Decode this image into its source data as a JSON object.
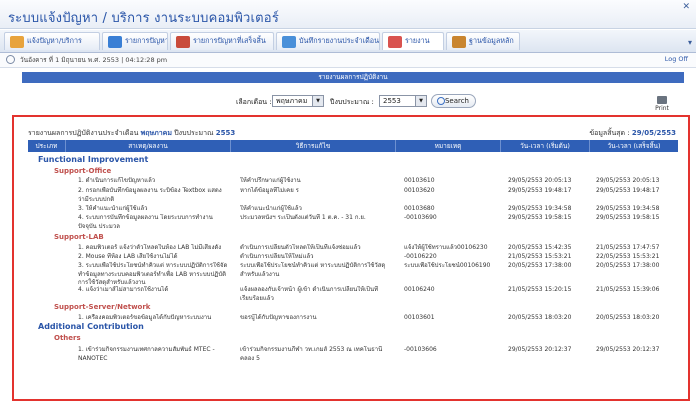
{
  "app": {
    "title": "ระบบแจ้งปัญหา / บริการ   งานระบบคอมพิวเตอร์"
  },
  "tabs": [
    {
      "label": "แจ้งปัญหา/บริการ",
      "color": "#e8a33c"
    },
    {
      "label": "รายการปัญหา",
      "color": "#3a7fd5"
    },
    {
      "label": "รายการปัญหาที่เสร็จสิ้น",
      "color": "#c94b3b"
    },
    {
      "label": "บันทึกรายงานประจำเดือน",
      "color": "#4a90d9"
    },
    {
      "label": "รายงาน",
      "color": "#d9534f"
    },
    {
      "label": "ฐานข้อมูลหลัก",
      "color": "#c9852f"
    }
  ],
  "status": {
    "date": "วันอังคาร ที่ 1 มิถุนายน พ.ศ. 2553  |  04:12:28 pm",
    "logoff": "Log Off"
  },
  "header_bar": "รายงานผลการปฏิบัติงาน",
  "filter": {
    "month_label": "เลือกเดือน :",
    "month_value": "พฤษภาคม",
    "year_label": "ปีงบประมาณ :",
    "year_value": "2553",
    "search_label": "Search",
    "print_label": "Print"
  },
  "report": {
    "title_prefix": "รายงานผลการปฏิบัติงานประจำเดือน",
    "month": "พฤษภาคม",
    "year_prefix": "ปีงบประมาณ",
    "year": "2553",
    "asof_label": "ข้อมูลสิ้นสุด :",
    "asof_date": "29/05/2553"
  },
  "columns": [
    "ประเภท",
    "สาเหตุ/ผลงาน",
    "วิธีการแก้ไข",
    "หมายเหตุ",
    "วัน-เวลา (เริ่มต้น)",
    "วัน-เวลา (เสร็จสิ้น)"
  ],
  "groups": [
    {
      "name": "Functional Improvement",
      "subs": [
        {
          "name": "Support-Office",
          "rows": [
            {
              "cause": "1. ดำเนินการแก้ไขปัญหาแล้ว",
              "fix": "ให้คำปรึกษาแก่ผู้ใช้งาน",
              "note": "00103610",
              "start": "29/05/2553  20:05:13",
              "end": "29/05/2553  20:05:13"
            },
            {
              "cause": "2. กรอกเพื่อบันทึกข้อมูลผลงาน ระบิข้อง Textbox แสดง ว่ามีระบบปกติ",
              "fix": "หากได้ข้อมูลที่ไม่เคย ร",
              "note": "00103620",
              "start": "29/05/2553  19:48:17",
              "end": "29/05/2553  19:48:17"
            },
            {
              "cause": "3. ให้คำแนะนำแก่ผู้ใช้แล้ว",
              "fix": "ให้คำแนะนำแก่ผู้ใช้แล้ว",
              "note": "00103680",
              "start": "29/05/2553  19:34:58",
              "end": "29/05/2553  19:34:58"
            },
            {
              "cause": "4. ระบบการบันทึกข้อมูลผลงาน โดยระบบการทำงานปัจจุบัน ประมวล",
              "fix": "ประมวลหนังฯ ระเป็นตั้งแต่วันที่ 1 ต.ค. - 31 ก.ย.",
              "note": "-00103690",
              "start": "29/05/2553  19:58:15",
              "end": "29/05/2553  19:58:15"
            }
          ]
        },
        {
          "name": "Support-LAB",
          "rows": [
            {
              "cause": "1. คอมพิวเตอร์ แจ้งว่าตัวโหลดในห้อง LAB ไม่มีเสียงดัง",
              "fix": "ดำเนินการเปลี่ยนตัวโหลดให้เป็นที่แจ้งซ่อมแล้ว",
              "note": "แจ้งให้ผู้ใช้ทราบแล้ว00106230",
              "start": "20/05/2553  15:42:35",
              "end": "21/05/2553  17:47:57"
            },
            {
              "cause": "2. Mouse ที่ห้อง LAB เสียใช้งานไม่ได้",
              "fix": "ดำเนินการเปลี่ยนให้ใหม่แล้ว",
              "note": "-00106220",
              "start": "21/05/2553  15:53:21",
              "end": "22/05/2553  15:53:21"
            },
            {
              "cause": "3. ระบบเพื่อใช้ประโยชน์ทำคิวแต่ หาระบบปฏิบัติการใช้จัดทำข้อมูลทางระบบคอมพิวเตอร์ทำเพื่อ LAB หาระบบปฏิบัติการใช้วัสดุสำหรับแล้วงาน",
              "fix": "ระบบเพื่อใช้ประโยชน์ทำคิวแต่ หาระบบปฏิบัติการใช้วัสดุสำหรับแล้วงาน",
              "note": "ระบบเพื่อใช้ประโยชน์00106190",
              "start": "20/05/2553  17:38:00",
              "end": "20/05/2553  17:38:00"
            },
            {
              "cause": "4. แจ้งว่าเมาส์ไม่สามารถใช้งานได้",
              "fix": "แจ้งผลลองกับเจ้าหน้า ผู้เข้า ดำเนินการเปลี่ยนให้เป็นที่เรียบร้อยแล้ว",
              "note": "00106240",
              "start": "21/05/2553  15:20:15",
              "end": "21/05/2553  15:39:06"
            }
          ]
        },
        {
          "name": "Support-Server/Network",
          "rows": [
            {
              "cause": "1. เครื่องคอมพิวเตอร์ขอข้อมูลได้กับปัญหาระบบงาน",
              "fix": "ขอรบู้ได้กับปัญหาของการงาน",
              "note": "00103601",
              "start": "20/05/2553  18:03:20",
              "end": "20/05/2553  18:03:20"
            }
          ]
        }
      ]
    },
    {
      "name": "Additional Contribution",
      "subs": [
        {
          "name": "Others",
          "rows": [
            {
              "cause": "1. เข้าร่วมกิจกรรมงานเทศกาลความสัมพันธ์ MTEC - NANOTEC",
              "fix": "เข้าร่วมกิจกรรมงานกีฬา วท.เกมส์ 2553 ณ เทคโนธานี คลอง 5",
              "note": "-00103606",
              "start": "29/05/2553  20:12:37",
              "end": "29/05/2553  20:12:37"
            }
          ]
        }
      ]
    }
  ]
}
